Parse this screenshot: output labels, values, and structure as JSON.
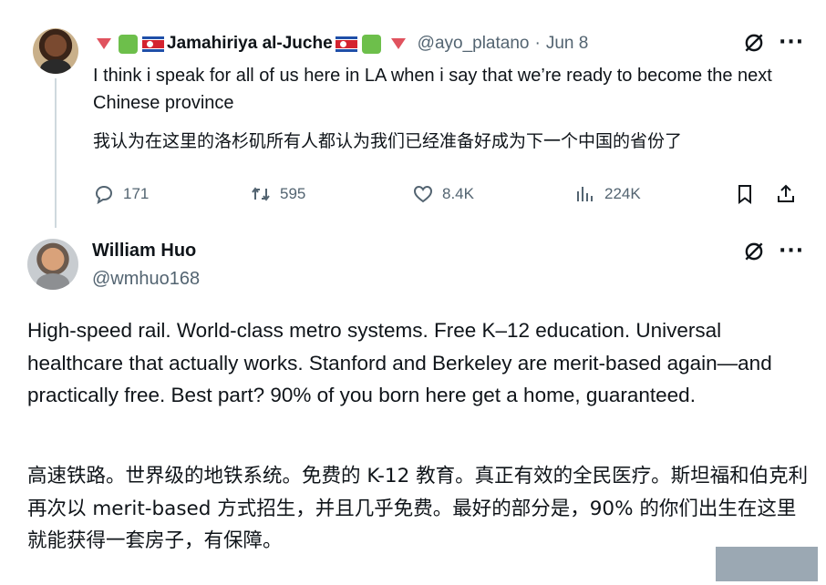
{
  "tweet1": {
    "display_name": "Jamahiriya al-Juche",
    "handle": "@ayo_platano",
    "separator": "·",
    "date": "Jun 8",
    "text_en": "I think i speak for all of us here in LA when i say that we’re ready to become the next Chinese province",
    "text_zh": "我认为在这里的洛杉矶所有人都认为我们已经准备好成为下一个中国的省份了",
    "stats": {
      "replies": "171",
      "reposts": "595",
      "likes": "8.4K",
      "views": "224K"
    },
    "icons": [
      "triangle-emoji",
      "green-square-emoji",
      "north-korea-flag",
      "grok-icon",
      "more-icon",
      "reply-icon",
      "repost-icon",
      "like-icon",
      "views-icon",
      "bookmark-icon",
      "share-icon"
    ]
  },
  "tweet2": {
    "display_name": "William Huo",
    "handle": "@wmhuo168",
    "text_en": "High-speed rail. World-class metro systems. Free K–12 education. Universal healthcare that actually works. Stanford and Berkeley are merit-based again—and practically free. Best part? 90% of you born here get a home, guaranteed.",
    "text_zh": "高速铁路。世界级的地铁系统。免费的 K-12 教育。真正有效的全民医疗。斯坦福和伯克利再次以 merit-based 方式招生，并且几乎免费。最好的部分是，90% 的你们出生在这里就能获得一套房子，有保障。",
    "icons": [
      "grok-icon",
      "more-icon"
    ]
  },
  "colors": {
    "text": "#0f1419",
    "secondary": "#536471",
    "thread_line": "#cfd9de"
  }
}
